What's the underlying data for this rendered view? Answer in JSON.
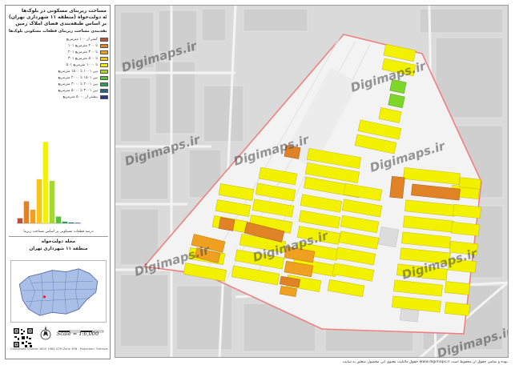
{
  "panel": {
    "title_lines": [
      "مساحت زیربنای مسکونی در بلوک‌ها",
      "در محله دولت‌خواه (منطقه ۱۱ شهرداری تهران)",
      "بر اساس طبقه‌بندی فضای املاک زمین"
    ],
    "legend_title": "طبقه‌بندی مساحت زیربنای قطعات مسکونی بلوک‌ها",
    "legend": [
      {
        "label": "کمتر از ۱۰۰ مترمربع",
        "color": "#b5533c"
      },
      {
        "label": "۱۰۱ تا ۲۰۰ مترمربع",
        "color": "#e08327"
      },
      {
        "label": "۲۰۱ تا ۳۰۰ مترمربع",
        "color": "#f0a020"
      },
      {
        "label": "۳۰۱ تا ۵۰۰ مترمربع",
        "color": "#f5c518"
      },
      {
        "label": "۵۰۱ تا ۱۰۰۰ مترمربع",
        "color": "#f2f200"
      },
      {
        "label": "بین ۱۰۰۱ تا ۱۵۰۰ مترمربع",
        "color": "#a6d92b"
      },
      {
        "label": "بین ۱۵۰۱ تا ۲۰۰۰ مترمربع",
        "color": "#58c23c"
      },
      {
        "label": "بین ۲۰۰۱ تا ۳۰۰۰ مترمربع",
        "color": "#2f9e4f"
      },
      {
        "label": "بین ۳۰۰۱ تا ۵۰۰۰ مترمربع",
        "color": "#1e6b7a"
      },
      {
        "label": "بیشتر از ۵۰۰۰ مترمربع",
        "color": "#253a8a"
      }
    ],
    "chart_caption": "درصد قطعات مسکونی بر اساس مساحت زیربنا",
    "region_lines": [
      "محله دولت‌خواه",
      "منطقه ۱۱ شهرداری تهران"
    ],
    "scale": "Scale = 1:6,000",
    "credit": "Coordinate System: WGS 1984 UTM Zone 39N · Projection: Transverse Mercator"
  },
  "chart_data": {
    "type": "bar",
    "categories": [
      "<100",
      "101-200",
      "201-300",
      "301-500",
      "501-1000",
      "1001-1500",
      "1501-2000",
      "2001-3000",
      "3001-5000",
      ">5000"
    ],
    "values": [
      3,
      13,
      8,
      26,
      48,
      25,
      4,
      1,
      0.5,
      0.3
    ],
    "colors": [
      "#b5533c",
      "#e08327",
      "#f0a020",
      "#f5c518",
      "#f2f200",
      "#a6d92b",
      "#58c23c",
      "#2f9e4f",
      "#1e6b7a",
      "#253a8a"
    ],
    "ylim": [
      0,
      50
    ]
  },
  "map": {
    "watermark": "Digimaps.ir"
  },
  "footer": "حقوق مالکیت معنوی این محصول متعلق به سایت www.digimaps.ir بوده و تمامی حقوق آن محفوظ است."
}
